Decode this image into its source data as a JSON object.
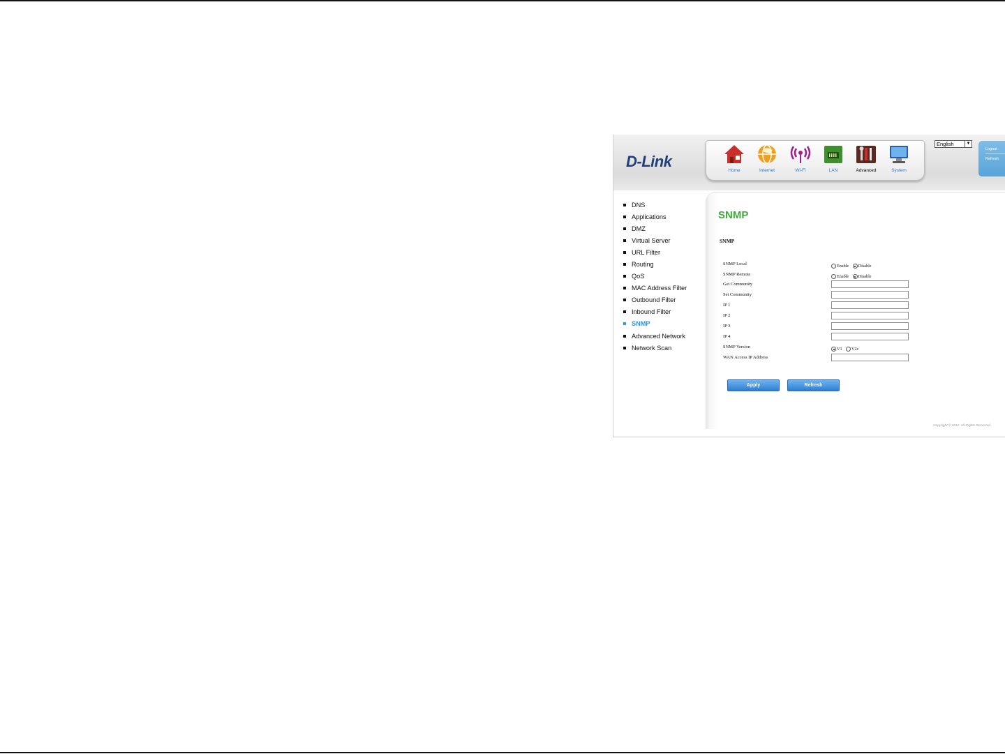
{
  "header": {
    "logo_text": "D-Link",
    "nav": [
      {
        "label": "Home",
        "icon": "home-icon"
      },
      {
        "label": "Internet",
        "icon": "globe-icon"
      },
      {
        "label": "Wi-Fi",
        "icon": "wifi-icon"
      },
      {
        "label": "LAN",
        "icon": "lan-icon"
      },
      {
        "label": "Advanced",
        "icon": "tools-icon"
      },
      {
        "label": "System",
        "icon": "monitor-icon"
      }
    ],
    "active_nav": "Advanced",
    "language": "English",
    "logout_label": "Logout",
    "refresh_label": "Refresh"
  },
  "sidebar": {
    "items": [
      {
        "label": "DNS"
      },
      {
        "label": "Applications"
      },
      {
        "label": "DMZ"
      },
      {
        "label": "Virtual Server"
      },
      {
        "label": "URL Filter"
      },
      {
        "label": "Routing"
      },
      {
        "label": "QoS"
      },
      {
        "label": "MAC Address Filter"
      },
      {
        "label": "Outbound Filter"
      },
      {
        "label": "Inbound Filter"
      },
      {
        "label": "SNMP"
      },
      {
        "label": "Advanced Network"
      },
      {
        "label": "Network Scan"
      }
    ],
    "active_item": "SNMP"
  },
  "main": {
    "title": "SNMP",
    "section": "SNMP",
    "fields": {
      "snmp_local": {
        "label": "SNMP Local",
        "option_enable": "Enable",
        "option_disable": "Disable",
        "value": "Disable"
      },
      "snmp_remote": {
        "label": "SNMP Remote",
        "option_enable": "Enable",
        "option_disable": "Disable",
        "value": "Disable"
      },
      "get_community": {
        "label": "Get Community",
        "value": ""
      },
      "set_community": {
        "label": "Set Community",
        "value": ""
      },
      "ip1": {
        "label": "IP 1",
        "value": ""
      },
      "ip2": {
        "label": "IP 2",
        "value": ""
      },
      "ip3": {
        "label": "IP 3",
        "value": ""
      },
      "ip4": {
        "label": "IP 4",
        "value": ""
      },
      "snmp_version": {
        "label": "SNMP Version",
        "option_v1": "V1",
        "option_v2c": "V2c",
        "value": "V1"
      },
      "wan_access_ip": {
        "label": "WAN Access IP Address",
        "value": ""
      }
    },
    "apply_label": "Apply",
    "refresh_label": "Refresh"
  },
  "footer": {
    "copyright": "Copyright © 2012. All Rights Reserved."
  },
  "colors": {
    "title_green": "#3eaa3a",
    "active_blue": "#2a9ad8",
    "nav_blue": "#2a78c8",
    "button_blue": "#2f7fd0"
  }
}
